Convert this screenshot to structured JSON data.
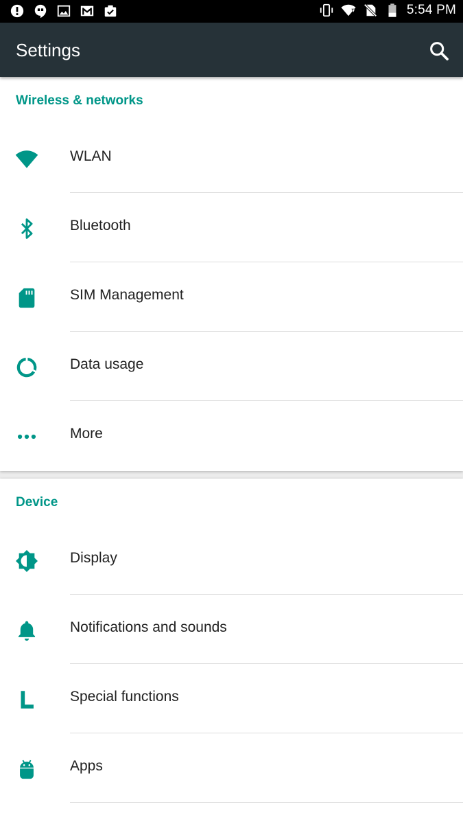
{
  "status_bar": {
    "time": "5:54 PM",
    "left_icons": [
      "alert-icon",
      "hangouts-icon",
      "image-icon",
      "gmail-icon",
      "tasks-icon"
    ],
    "right_icons": [
      "vibrate-icon",
      "wifi-signal-icon",
      "no-sim-icon",
      "battery-icon"
    ]
  },
  "app_bar": {
    "title": "Settings",
    "search_icon": "search-icon"
  },
  "sections": [
    {
      "title": "Wireless & networks",
      "items": [
        {
          "label": "WLAN",
          "icon": "wifi-icon"
        },
        {
          "label": "Bluetooth",
          "icon": "bluetooth-icon"
        },
        {
          "label": "SIM Management",
          "icon": "sim-card-icon"
        },
        {
          "label": "Data usage",
          "icon": "data-usage-icon"
        },
        {
          "label": "More",
          "icon": "more-dots-icon"
        }
      ]
    },
    {
      "title": "Device",
      "items": [
        {
          "label": "Display",
          "icon": "brightness-icon"
        },
        {
          "label": "Notifications and sounds",
          "icon": "bell-icon"
        },
        {
          "label": "Special functions",
          "icon": "special-functions-icon"
        },
        {
          "label": "Apps",
          "icon": "android-icon"
        }
      ]
    }
  ],
  "colors": {
    "accent": "#009688",
    "app_bar": "#263238",
    "status_bar": "#000000",
    "text_primary": "#212121"
  }
}
